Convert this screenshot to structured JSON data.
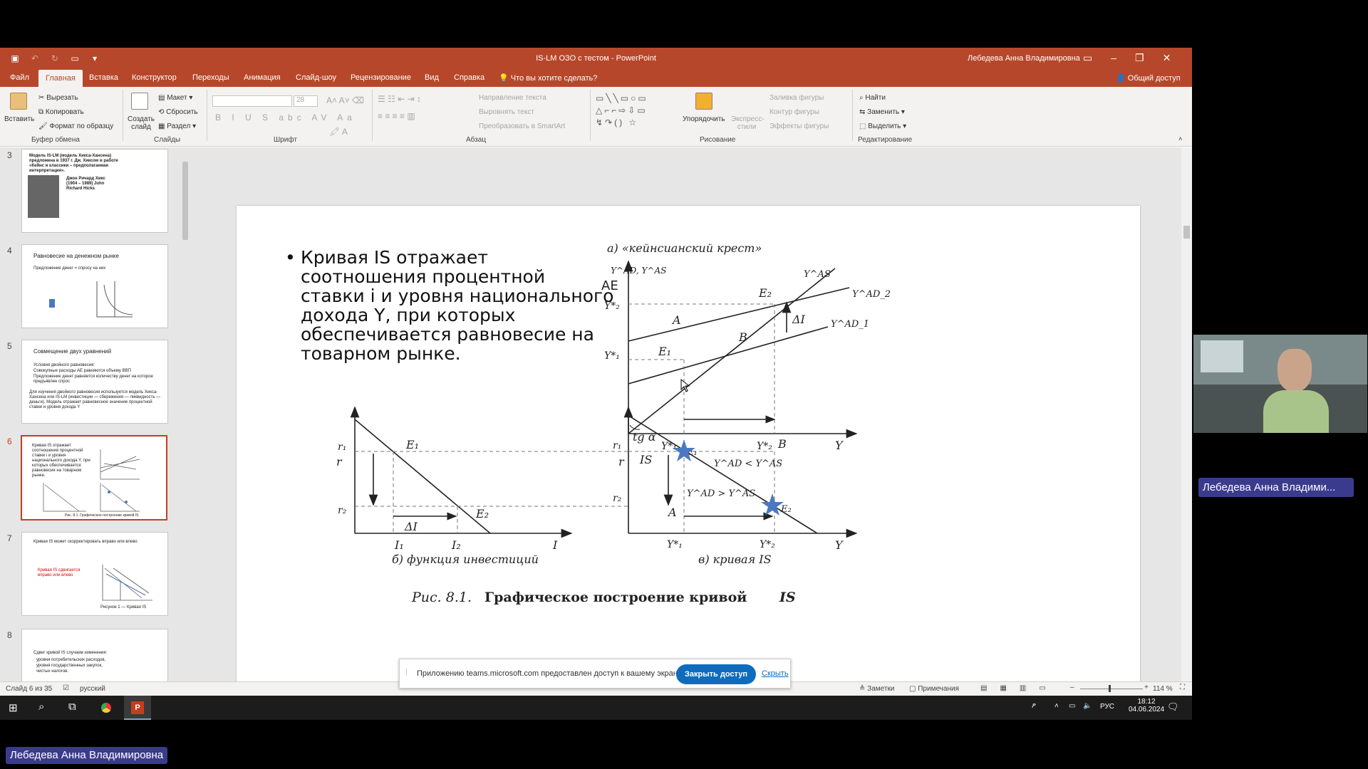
{
  "window": {
    "title": "IS-LM ОЗО с тестом  -  PowerPoint",
    "user": "Лебедева Анна Владимировна"
  },
  "tabs": [
    "Файл",
    "Главная",
    "Вставка",
    "Конструктор",
    "Переходы",
    "Анимация",
    "Слайд-шоу",
    "Рецензирование",
    "Вид",
    "Справка"
  ],
  "tell_me": "Что вы хотите сделать?",
  "share": "Общий доступ",
  "ribbon": {
    "clipboard": {
      "paste": "Вставить",
      "cut": "Вырезать",
      "copy": "Копировать",
      "format": "Формат по образцу",
      "label": "Буфер обмена"
    },
    "slides": {
      "new": "Создать слайд",
      "layout": "Макет",
      "reset": "Сбросить",
      "section": "Раздел",
      "label": "Слайды"
    },
    "font": {
      "size": "28",
      "label": "Шрифт"
    },
    "paragraph": {
      "dir": "Направление текста",
      "align": "Выровнять текст",
      "smartart": "Преобразовать в SmartArt",
      "label": "Абзац"
    },
    "drawing": {
      "arrange": "Упорядочить",
      "styles": "Экспресс-стили",
      "fill": "Заливка фигуры",
      "outline": "Контур фигуры",
      "effects": "Эффекты фигуры",
      "label": "Рисование"
    },
    "editing": {
      "find": "Найти",
      "replace": "Заменить",
      "select": "Выделить",
      "label": "Редактирование"
    }
  },
  "thumbs": {
    "numbers": [
      "3",
      "4",
      "5",
      "6",
      "7",
      "8"
    ],
    "s3": {
      "title": "Модель IS-LM (модель Хикса-Хансена) предложена в 1937 г. Дж. Хиксом в работе «Кейнс и классики – предполагаемая интерпретация».",
      "name": "Джон Ричард Хикс (1904 – 1989) John Richard Hicks"
    },
    "s4": {
      "title": "Равновесие на денежном рынке",
      "line": "Предложение денег = спросу на них"
    },
    "s5": {
      "title": "Совмещение двух уравнений",
      "l1": "Условия двойного равновесия:",
      "l2": "Совокупные расходы AE равняются объему ВВП",
      "l3": "Предложение денег равняется количеству денег на которое предъявлен спрос",
      "l4": "Для изучения двойного равновесия используется модель Хикса-Хансена или IS-LM (инвестиции — сбережения — ликвидность — деньги). Модель отражает равновесное значение процентной ставки и уровня дохода Y"
    },
    "s6": {
      "title": "Кривая IS отражает соотношения процентной ставки i и уровня национального дохода Y, при которых обеспечивается равновесие на товарном рынке.",
      "caption": "Рис. 8.1. Графическое построение кривой IS"
    },
    "s7": {
      "title": "Кривая IS может скорректировать вправо или влево",
      "red": "Кривая IS сдвигается вправо или влево",
      "caption": "Рисунок 1 — Кривая IS"
    },
    "s8": {
      "title": "Сдвиг кривой IS случаем изменения:",
      "l1": "уровня потребительских расходов,",
      "l2": "уровня государственных закупок,",
      "l3": "чистых налогов."
    }
  },
  "slide": {
    "bullet": "Кривая IS отражает соотношения процентной ставки i и уровня национального дохода Y, при которых обеспечивается равновесие на товарном рынке.",
    "fig_a": "а) «кейнсианский крест»",
    "ae": "AE",
    "fig_b": "б) функция инвестиций",
    "fig_c": "в) кривая IS",
    "caption_prefix": "Рис. 8.1.",
    "caption_text": "Графическое построение кривой",
    "caption_is": "IS",
    "labels": {
      "yad_yas": "Y^AD, Y^AS",
      "yas": "Y^AS",
      "yad2": "Y^AD_2",
      "yad1": "Y^AD_1",
      "e2": "E₂",
      "e1": "E₁",
      "a": "A",
      "b": "B",
      "di": "ΔI",
      "y2s": "Y*₂",
      "y1s": "Y*₁",
      "y": "Y",
      "r": "r",
      "r1": "r₁",
      "r2": "r₂",
      "i1": "I₁",
      "i2": "I₂",
      "i": "I",
      "is": "IS",
      "tga": "tg α",
      "ineq1": "Y^AD < Y^AS",
      "ineq2": "Y^AD > Y^AS"
    }
  },
  "status": {
    "slide": "Слайд 6 из 35",
    "lang": "русский",
    "notes": "Заметки",
    "comments": "Примечания",
    "zoom": "114 %"
  },
  "notification": {
    "text": "Приложению teams.microsoft.com предоставлен доступ к вашему экрану.",
    "button": "Закрыть доступ",
    "hide": "Скрыть"
  },
  "taskbar": {
    "lang": "РУС",
    "time": "18:12",
    "date": "04.06.2024"
  },
  "participant": {
    "name_right": "Лебедева Анна Владими...",
    "name_left": "Лебедева Анна Владимировна"
  }
}
